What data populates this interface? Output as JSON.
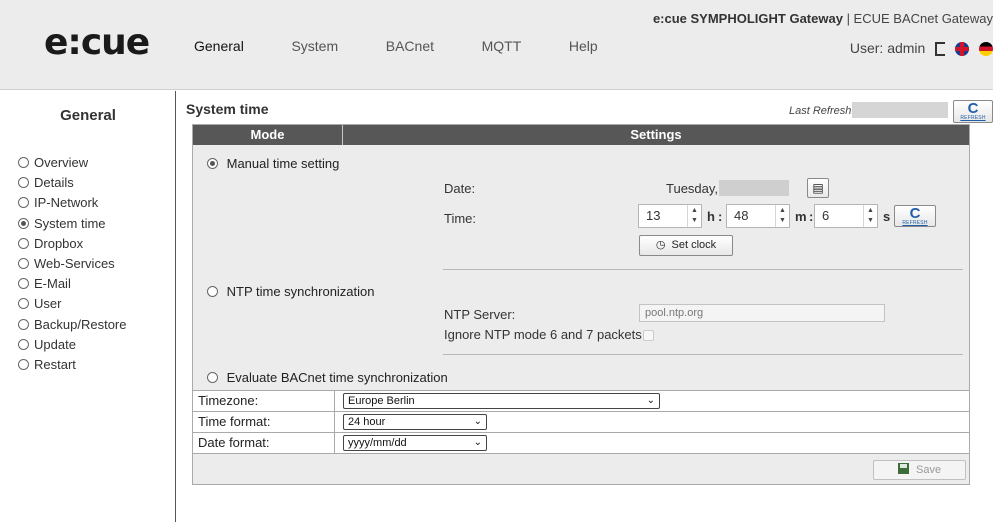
{
  "header": {
    "logo": "e:cue",
    "nav": [
      "General",
      "System",
      "BACnet",
      "MQTT",
      "Help"
    ],
    "active_nav": "General",
    "product_bold": "e:cue SYMPHOLIGHT Gateway",
    "product_rest": "| ECUE BACnet Gateway",
    "user_text": "User: admin"
  },
  "sidebar": {
    "title": "General",
    "items": [
      {
        "label": "Overview"
      },
      {
        "label": "Details"
      },
      {
        "label": "IP-Network"
      },
      {
        "label": "System time",
        "selected": true
      },
      {
        "label": "Dropbox"
      },
      {
        "label": "Web-Services"
      },
      {
        "label": "E-Mail"
      },
      {
        "label": "User"
      },
      {
        "label": "Backup/Restore"
      },
      {
        "label": "Update"
      },
      {
        "label": "Restart"
      }
    ]
  },
  "main": {
    "title": "System time",
    "last_refresh_label": "Last Refresh:",
    "refresh_label": "REFRESH",
    "refresh_glyph": "C",
    "table_header": {
      "mode": "Mode",
      "settings": "Settings"
    },
    "manual": {
      "label": "Manual time setting",
      "selected": true,
      "date_label": "Date:",
      "date_value": "Tuesday,",
      "time_label": "Time:",
      "hour": "13",
      "minute": "48",
      "second": "6",
      "hour_unit": "h",
      "minute_unit": "m",
      "second_unit": "s",
      "set_clock": "Set clock"
    },
    "ntp": {
      "label": "NTP time synchronization",
      "server_label": "NTP Server:",
      "server_value": "pool.ntp.org",
      "ignore_label": "Ignore NTP mode 6 and 7 packets"
    },
    "bacnet": {
      "label": "Evaluate BACnet time synchronization"
    },
    "rows": [
      {
        "label": "Timezone:",
        "value": "Europe Berlin"
      },
      {
        "label": "Time format:",
        "value": "24 hour"
      },
      {
        "label": "Date format:",
        "value": "yyyy/mm/dd"
      }
    ],
    "save_label": "Save"
  }
}
